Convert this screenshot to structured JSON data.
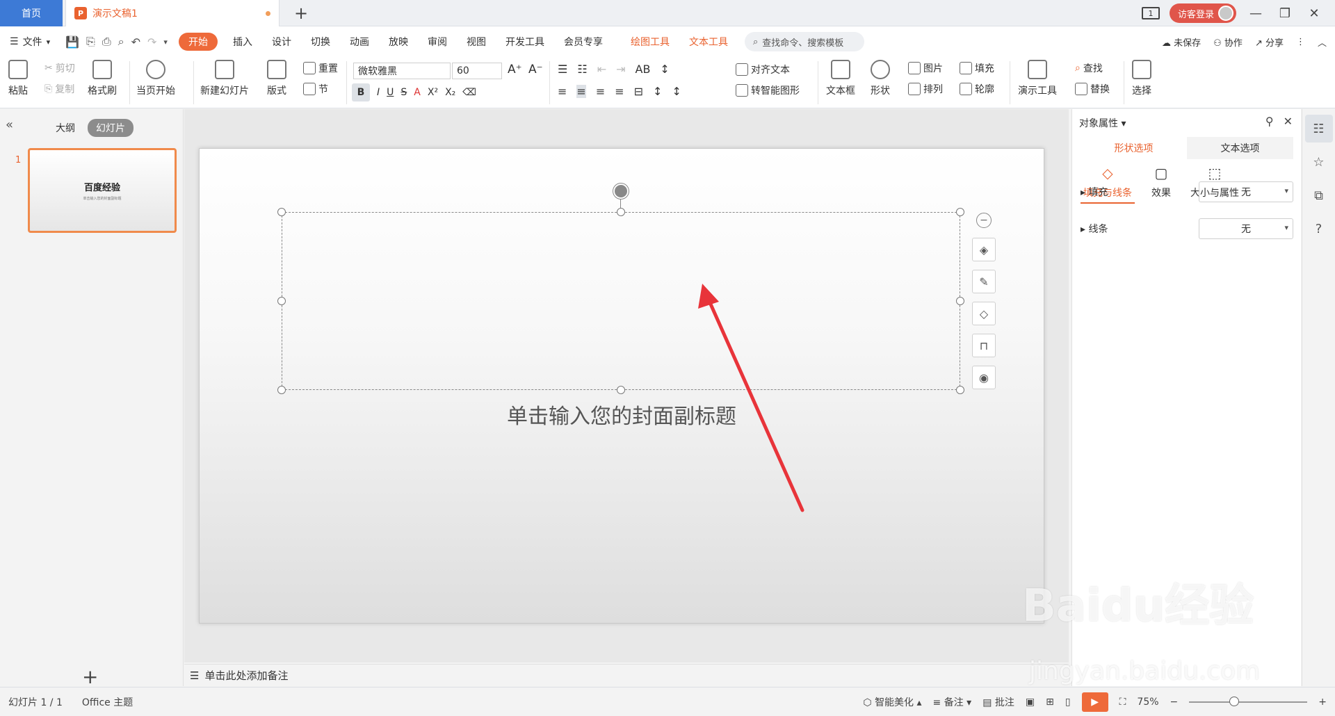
{
  "titlebar": {
    "home": "首页",
    "doc_tab": "演示文稿1",
    "login": "访客登录"
  },
  "menu": {
    "file": "文件",
    "tabs": [
      "开始",
      "插入",
      "设计",
      "切换",
      "动画",
      "放映",
      "审阅",
      "视图",
      "开发工具",
      "会员专享",
      "绘图工具",
      "文本工具"
    ],
    "search": "查找命令、搜索模板",
    "unsaved": "未保存",
    "collab": "协作",
    "share": "分享"
  },
  "ribbon": {
    "paste": "粘贴",
    "cut": "剪切",
    "copy": "复制",
    "format_painter": "格式刷",
    "play_from_current": "当页开始",
    "new_slide": "新建幻灯片",
    "layout": "版式",
    "reset": "重置",
    "section": "节",
    "font_name": "微软雅黑",
    "font_size": "60",
    "align_text": "对齐文本",
    "convert_smartart": "转智能图形",
    "textbox": "文本框",
    "shape": "形状",
    "picture": "图片",
    "arrange": "排列",
    "fill": "填充",
    "outline": "轮廓",
    "present_tools": "演示工具",
    "find": "查找",
    "replace": "替换",
    "select": "选择"
  },
  "left": {
    "outline": "大纲",
    "slides": "幻灯片",
    "slide_num": "1",
    "thumb_title": "百度经验",
    "thumb_sub": "单击输入您的封面副标题"
  },
  "slide": {
    "subtitle": "单击输入您的封面副标题"
  },
  "notes": "单击此处添加备注",
  "rightpanel": {
    "title": "对象属性",
    "tab_shape": "形状选项",
    "tab_text": "文本选项",
    "sub_fill": "填充与线条",
    "sub_effect": "效果",
    "sub_size": "大小与属性",
    "fill_label": "填充",
    "fill_value": "无",
    "line_label": "线条",
    "line_value": "无"
  },
  "status": {
    "slide_info": "幻灯片 1 / 1",
    "theme": "Office 主题",
    "beautify": "智能美化",
    "notes": "备注",
    "comments": "批注",
    "zoom": "75%"
  },
  "watermark": {
    "logo": "Baidu经验",
    "url": "jingyan.baidu.com"
  },
  "colors": {
    "accent": "#e9622f",
    "home_tab": "#3d7ad6",
    "arrow": "#e8343a"
  }
}
